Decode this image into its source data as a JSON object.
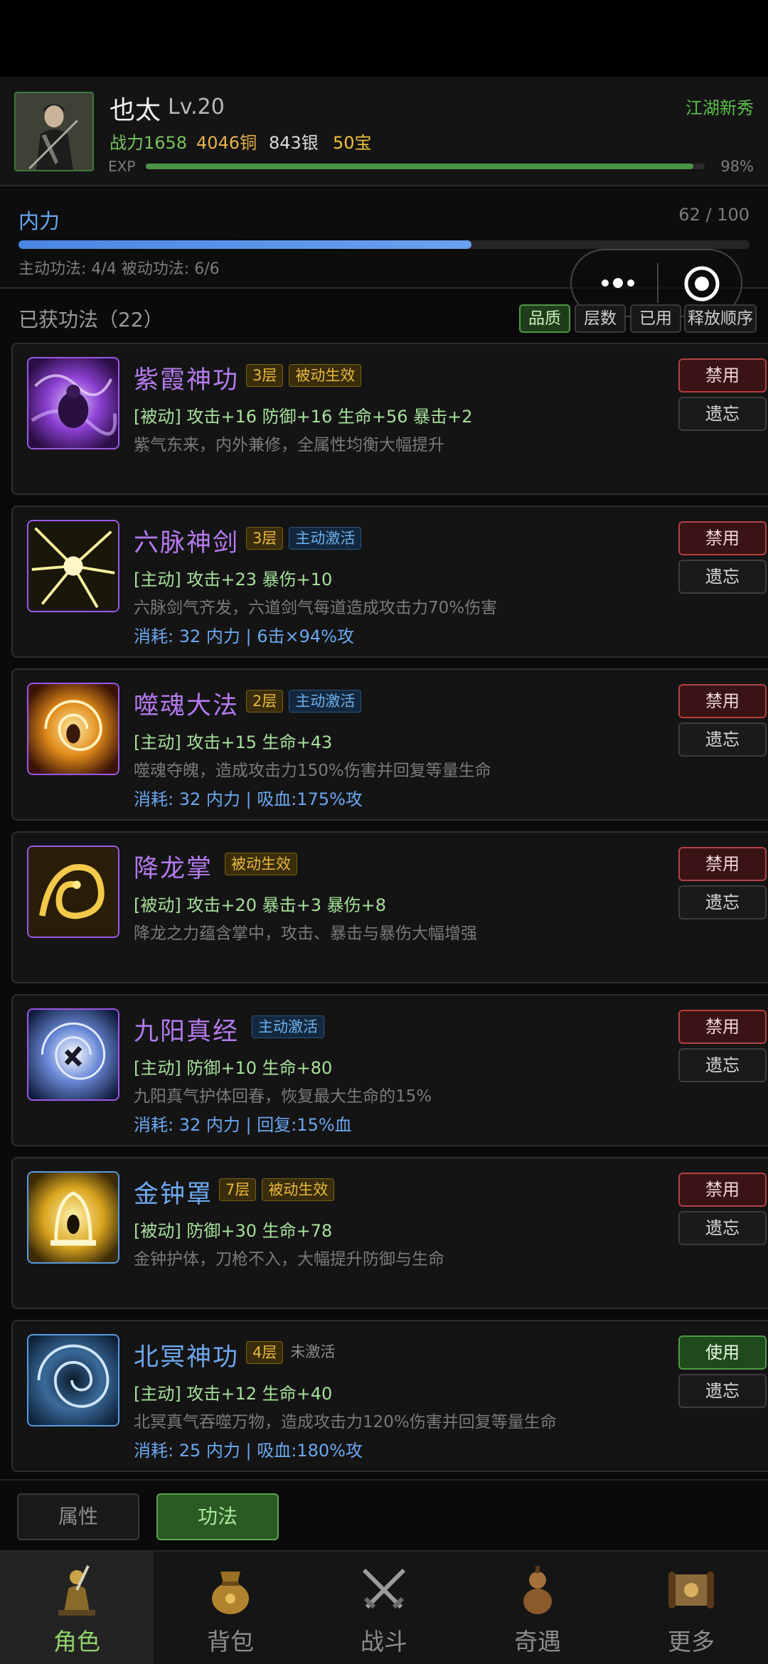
{
  "player": {
    "name": "也太",
    "level": "Lv.20",
    "title": "江湖新秀",
    "power": "战力1658",
    "copper": "4046铜",
    "silver": "843银",
    "treasure": "50宝",
    "exp_label": "EXP",
    "exp_percent_text": "98%",
    "exp_fraction": 0.98
  },
  "inner_power": {
    "label": "内力",
    "value_text": "62 / 100",
    "fraction": 0.62,
    "slots_text": "主动功法: 4/4  被动功法: 6/6"
  },
  "skills_header": {
    "title": "已获功法（22）",
    "sort_buttons": [
      "品质",
      "层数",
      "已用",
      "释放顺序"
    ],
    "active_sort": "品质"
  },
  "skills": [
    {
      "name": "紫霞神功",
      "layer": "3层",
      "type": "被动生效",
      "type_kind": "passive",
      "stats": "[被动] 攻击+16 防御+16 生命+56 暴击+2",
      "desc": "紫气东来，内外兼修，全属性均衡大幅提升",
      "cost": "",
      "toggle": "禁用",
      "forget": "遗忘",
      "color": "purple",
      "icon": "purple-meditation-icon"
    },
    {
      "name": "六脉神剑",
      "layer": "3层",
      "type": "主动激活",
      "type_kind": "active",
      "stats": "[主动] 攻击+23 暴伤+10",
      "desc": "六脉剑气齐发，六道剑气每道造成攻击力70%伤害",
      "cost": "消耗: 32 内力 | 6击×94%攻",
      "toggle": "禁用",
      "forget": "遗忘",
      "color": "purple",
      "icon": "sword-qi-burst-icon"
    },
    {
      "name": "噬魂大法",
      "layer": "2层",
      "type": "主动激活",
      "type_kind": "active",
      "stats": "[主动] 攻击+15 生命+43",
      "desc": "噬魂夺魄，造成攻击力150%伤害并回复等量生命",
      "cost": "消耗: 32 内力 | 吸血:175%攻",
      "toggle": "禁用",
      "forget": "遗忘",
      "color": "purple",
      "icon": "soul-vortex-icon"
    },
    {
      "name": "降龙掌",
      "layer": "",
      "type": "被动生效",
      "type_kind": "passive",
      "stats": "[被动] 攻击+20 暴击+3 暴伤+8",
      "desc": "降龙之力蕴含掌中，攻击、暴击与暴伤大幅增强",
      "cost": "",
      "toggle": "禁用",
      "forget": "遗忘",
      "color": "purple",
      "icon": "golden-dragon-icon"
    },
    {
      "name": "九阳真经",
      "layer": "",
      "type": "主动激活",
      "type_kind": "active",
      "stats": "[主动] 防御+10 生命+80",
      "desc": "九阳真气护体回春，恢复最大生命的15%",
      "cost": "消耗: 32 内力 | 回复:15%血",
      "toggle": "禁用",
      "forget": "遗忘",
      "color": "purple",
      "icon": "sun-swirl-icon"
    },
    {
      "name": "金钟罩",
      "layer": "7层",
      "type": "被动生效",
      "type_kind": "passive",
      "stats": "[被动] 防御+30 生命+78",
      "desc": "金钟护体，刀枪不入，大幅提升防御与生命",
      "cost": "",
      "toggle": "禁用",
      "forget": "遗忘",
      "color": "blue",
      "icon": "golden-bell-icon"
    },
    {
      "name": "北冥神功",
      "layer": "4层",
      "type": "未激活",
      "type_kind": "inactive",
      "stats": "[主动] 攻击+12 生命+40",
      "desc": "北冥真气吞噬万物，造成攻击力120%伤害并回复等量生命",
      "cost": "消耗: 25 内力 | 吸血:180%攻",
      "toggle": "使用",
      "forget": "遗忘",
      "color": "blue",
      "icon": "ocean-vortex-icon"
    }
  ],
  "subtabs": {
    "attributes": "属性",
    "skills": "功法",
    "active": "功法"
  },
  "nav": [
    {
      "label": "角色",
      "icon": "warrior-icon",
      "active": true
    },
    {
      "label": "背包",
      "icon": "money-bag-icon",
      "active": false
    },
    {
      "label": "战斗",
      "icon": "crossed-swords-icon",
      "active": false
    },
    {
      "label": "奇遇",
      "icon": "gourd-icon",
      "active": false
    },
    {
      "label": "更多",
      "icon": "scroll-icon",
      "active": false
    }
  ],
  "colors": {
    "accent_green": "#5aa84d",
    "power_blue": "#4a86e4",
    "skill_purple": "#b57aef",
    "skill_blue": "#6ea8ef",
    "danger_red": "#b54040"
  }
}
